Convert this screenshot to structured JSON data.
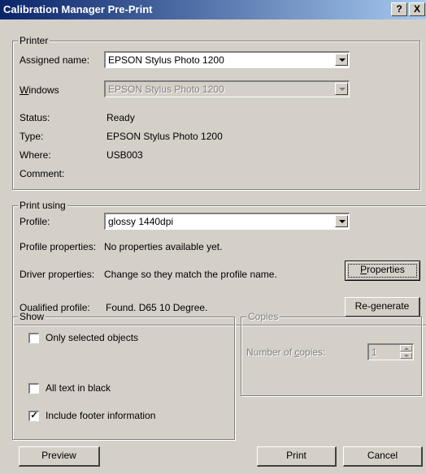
{
  "window": {
    "title": "Calibration Manager Pre-Print",
    "help_label": "?",
    "close_label": "X"
  },
  "printer": {
    "legend": "Printer",
    "assigned_label": "Assigned name:",
    "assigned_value": "EPSON Stylus Photo 1200",
    "windows_label_pre": "",
    "windows_label_u": "W",
    "windows_label_post": "indows",
    "windows_value": "EPSON Stylus Photo 1200",
    "status_label": "Status:",
    "status_value": "Ready",
    "type_label": "Type:",
    "type_value": "EPSON Stylus Photo 1200",
    "where_label": "Where:",
    "where_value": "USB003",
    "comment_label": "Comment:",
    "comment_value": ""
  },
  "print_using": {
    "legend": "Print using",
    "profile_label": "Profile:",
    "profile_value": "glossy 1440dpi",
    "profile_props_label": "Profile properties:",
    "profile_props_value": "No properties available yet.",
    "driver_props_label": "Driver properties:",
    "driver_props_value": "Change so they match the profile name.",
    "properties_btn_u": "P",
    "properties_btn_rest": "roperties",
    "qualified_label": "Qualified profile:",
    "qualified_value": "Found. D65 10 Degree.",
    "regenerate_btn": "Re-generate"
  },
  "show": {
    "legend": "Show",
    "items": [
      {
        "label": "Only selected objects",
        "checked": false
      },
      {
        "label": "All text in black",
        "checked": false
      },
      {
        "label": "Include footer information",
        "checked": true
      }
    ]
  },
  "copies": {
    "legend": "Copies",
    "label_pre": "Number of ",
    "label_u": "c",
    "label_post": "opies:",
    "value": "1"
  },
  "buttons": {
    "preview": "Preview",
    "print": "Print",
    "cancel": "Cancel"
  }
}
